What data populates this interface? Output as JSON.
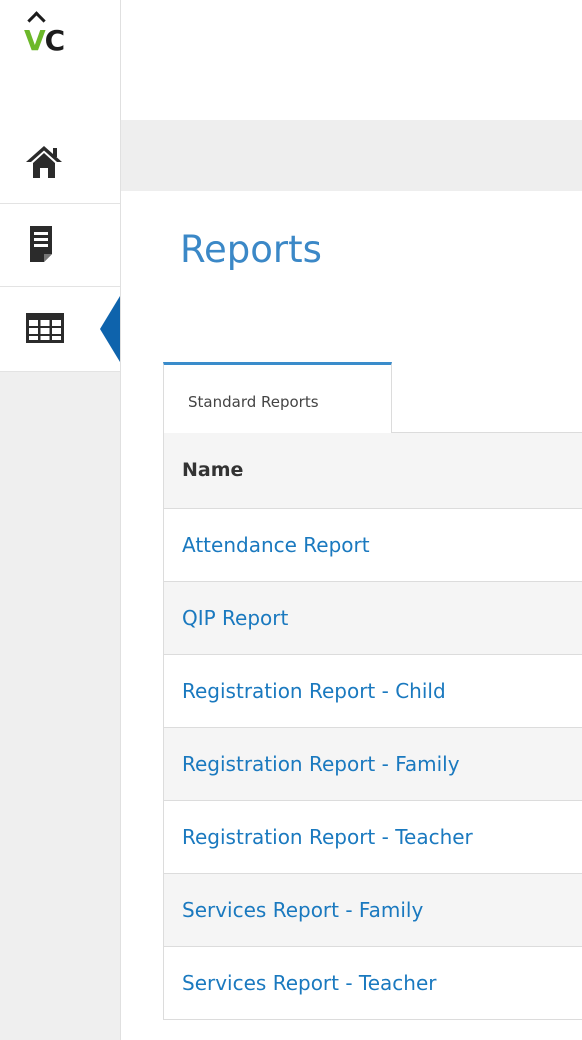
{
  "logo": {
    "letter_v": "V",
    "letter_c": "C"
  },
  "sidebar": {
    "items": [
      {
        "icon": "home-icon"
      },
      {
        "icon": "document-icon"
      },
      {
        "icon": "table-icon",
        "active": true
      }
    ]
  },
  "main": {
    "title": "Reports",
    "tabs": [
      {
        "label": "Standard Reports",
        "active": true
      }
    ],
    "table": {
      "header": "Name",
      "rows": [
        "Attendance Report",
        "QIP Report",
        "Registration Report - Child",
        "Registration Report - Family",
        "Registration Report - Teacher",
        "Services Report - Family",
        "Services Report - Teacher"
      ]
    }
  },
  "colors": {
    "accent": "#3b88c7",
    "link": "#1a79bf",
    "active_pointer": "#0e63ac",
    "logo_green": "#6cb82a"
  }
}
